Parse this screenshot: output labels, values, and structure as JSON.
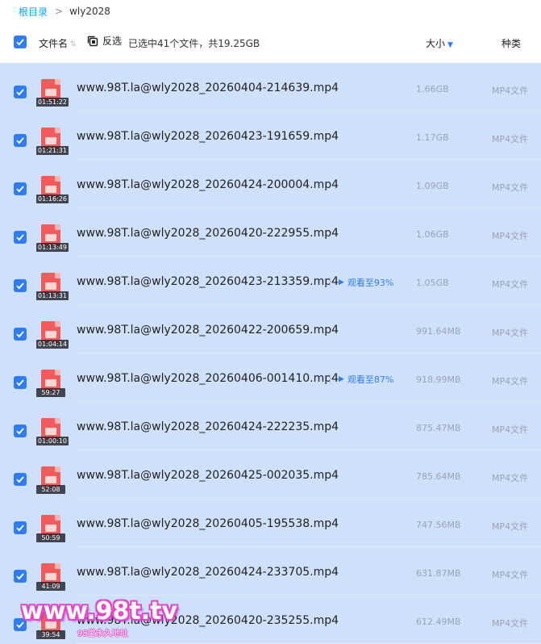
{
  "breadcrumb": {
    "root": "根目录",
    "separator": ">",
    "current": "wly2028"
  },
  "header": {
    "name_label": "文件名",
    "invert_label": "反选",
    "selection_info": "已选中41个文件，共19.25GB",
    "size_label": "大小",
    "type_label": "种类"
  },
  "colors": {
    "accent": "#2f7df6",
    "selected_bg": "#cfe0fb",
    "file_icon": "#f25b5b"
  },
  "files": [
    {
      "name": "www.98T.la@wly2028_20260404-214639.mp4",
      "duration": "01:51:22",
      "size": "1.66GB",
      "type": "MP4文件",
      "watch": ""
    },
    {
      "name": "www.98T.la@wly2028_20260423-191659.mp4",
      "duration": "01:21:31",
      "size": "1.17GB",
      "type": "MP4文件",
      "watch": ""
    },
    {
      "name": "www.98T.la@wly2028_20260424-200004.mp4",
      "duration": "01:16:26",
      "size": "1.09GB",
      "type": "MP4文件",
      "watch": ""
    },
    {
      "name": "www.98T.la@wly2028_20260420-222955.mp4",
      "duration": "01:13:49",
      "size": "1.06GB",
      "type": "MP4文件",
      "watch": ""
    },
    {
      "name": "www.98T.la@wly2028_20260423-213359.mp4",
      "duration": "01:13:31",
      "size": "1.05GB",
      "type": "MP4文件",
      "watch": "观看至93%"
    },
    {
      "name": "www.98T.la@wly2028_20260422-200659.mp4",
      "duration": "01:04:14",
      "size": "991.64MB",
      "type": "MP4文件",
      "watch": ""
    },
    {
      "name": "www.98T.la@wly2028_20260406-001410.mp4",
      "duration": "59:27",
      "size": "918.99MB",
      "type": "MP4文件",
      "watch": "观看至87%"
    },
    {
      "name": "www.98T.la@wly2028_20260424-222235.mp4",
      "duration": "01:00:10",
      "size": "875.47MB",
      "type": "MP4文件",
      "watch": ""
    },
    {
      "name": "www.98T.la@wly2028_20260425-002035.mp4",
      "duration": "52:08",
      "size": "785.64MB",
      "type": "MP4文件",
      "watch": ""
    },
    {
      "name": "www.98T.la@wly2028_20260405-195538.mp4",
      "duration": "50:59",
      "size": "747.56MB",
      "type": "MP4文件",
      "watch": ""
    },
    {
      "name": "www.98T.la@wly2028_20260424-233705.mp4",
      "duration": "41:09",
      "size": "631.87MB",
      "type": "MP4文件",
      "watch": ""
    },
    {
      "name": "www.98T.la@wly2028_20260420-235255.mp4",
      "duration": "39:54",
      "size": "612.49MB",
      "type": "MP4文件",
      "watch": ""
    }
  ],
  "watermark": {
    "main": "www.98t.tv",
    "sub": "98堂永久地址"
  }
}
